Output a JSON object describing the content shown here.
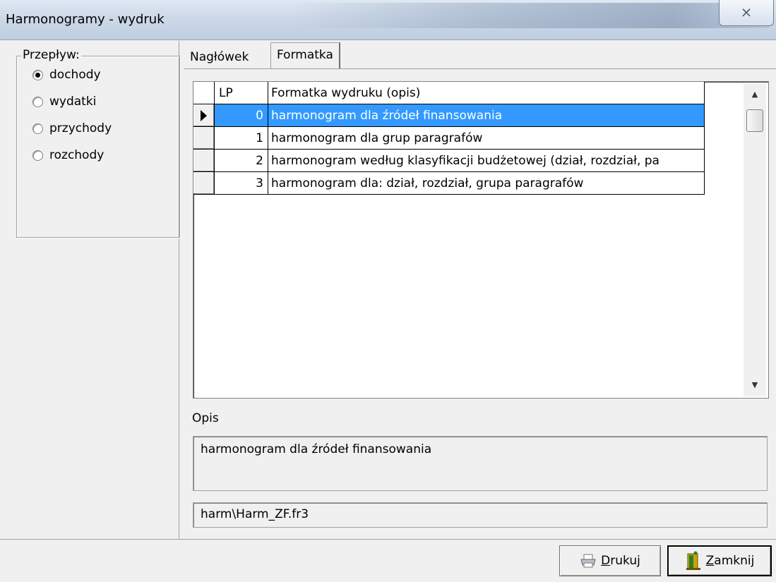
{
  "window": {
    "title": "Harmonogramy - wydruk",
    "close_label": "⨯"
  },
  "przeplyw": {
    "legend": "Przepływ:",
    "options": [
      {
        "label": "dochody",
        "checked": true
      },
      {
        "label": "wydatki",
        "checked": false
      },
      {
        "label": "przychody",
        "checked": false
      },
      {
        "label": "rozchody",
        "checked": false
      }
    ]
  },
  "tabs": [
    {
      "label": "Nagłówek",
      "active": false
    },
    {
      "label": "Formatka",
      "active": true
    }
  ],
  "grid": {
    "columns": [
      "LP",
      "Formatka wydruku (opis)"
    ],
    "rows": [
      {
        "lp": "0",
        "desc": "harmonogram dla źródeł finansowania",
        "selected": true
      },
      {
        "lp": "1",
        "desc": "harmonogram dla grup paragrafów",
        "selected": false
      },
      {
        "lp": "2",
        "desc": "harmonogram według klasyfikacji budżetowej (dział, rozdział, pa",
        "selected": false
      },
      {
        "lp": "3",
        "desc": "harmonogram dla: dział, rozdział, grupa paragrafów",
        "selected": false
      }
    ]
  },
  "opis": {
    "label": "Opis",
    "value": "harmonogram dla źródeł finansowania",
    "path": "harm\\Harm_ZF.fr3"
  },
  "buttons": {
    "drukuj": {
      "accel": "D",
      "rest": "rukuj",
      "icon": "printer-icon"
    },
    "zamknij": {
      "accel": "Z",
      "rest": "amknij",
      "icon": "exit-door-icon"
    }
  },
  "colors": {
    "selection": "#3399ff",
    "face": "#f0f0f0"
  }
}
